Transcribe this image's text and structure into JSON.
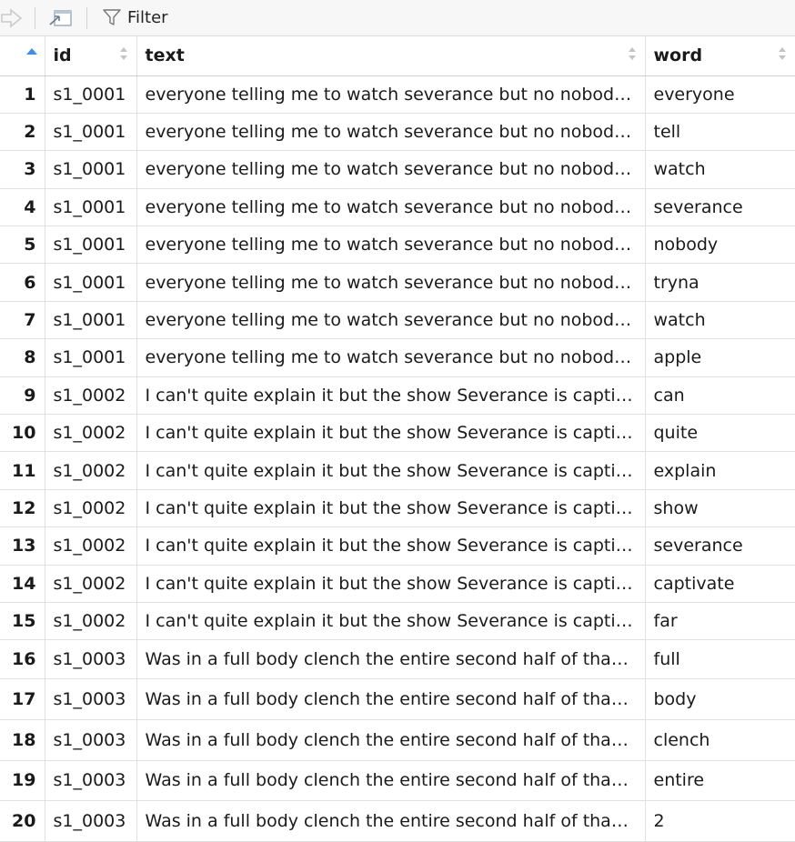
{
  "toolbar": {
    "filter_label": "Filter",
    "icons": [
      "forward-arrow-icon",
      "popout-window-icon",
      "filter-icon"
    ]
  },
  "table": {
    "columns": [
      {
        "label": "",
        "sort": "ascending"
      },
      {
        "label": "id",
        "sort": "none"
      },
      {
        "label": "text",
        "sort": "none"
      },
      {
        "label": "word",
        "sort": "none"
      }
    ],
    "rows": [
      {
        "n": "1",
        "id": "s1_0001",
        "text": "everyone telling me to watch severance but no nobod…",
        "word": "everyone"
      },
      {
        "n": "2",
        "id": "s1_0001",
        "text": "everyone telling me to watch severance but no nobod…",
        "word": "tell"
      },
      {
        "n": "3",
        "id": "s1_0001",
        "text": "everyone telling me to watch severance but no nobod…",
        "word": "watch"
      },
      {
        "n": "4",
        "id": "s1_0001",
        "text": "everyone telling me to watch severance but no nobod…",
        "word": "severance"
      },
      {
        "n": "5",
        "id": "s1_0001",
        "text": "everyone telling me to watch severance but no nobod…",
        "word": "nobody"
      },
      {
        "n": "6",
        "id": "s1_0001",
        "text": "everyone telling me to watch severance but no nobod…",
        "word": "tryna"
      },
      {
        "n": "7",
        "id": "s1_0001",
        "text": "everyone telling me to watch severance but no nobod…",
        "word": "watch"
      },
      {
        "n": "8",
        "id": "s1_0001",
        "text": "everyone telling me to watch severance but no nobod…",
        "word": "apple"
      },
      {
        "n": "9",
        "id": "s1_0002",
        "text": "I can't quite explain it but the show Severance is capti…",
        "word": "can"
      },
      {
        "n": "10",
        "id": "s1_0002",
        "text": "I can't quite explain it but the show Severance is capti…",
        "word": "quite"
      },
      {
        "n": "11",
        "id": "s1_0002",
        "text": "I can't quite explain it but the show Severance is capti…",
        "word": "explain"
      },
      {
        "n": "12",
        "id": "s1_0002",
        "text": "I can't quite explain it but the show Severance is capti…",
        "word": "show"
      },
      {
        "n": "13",
        "id": "s1_0002",
        "text": "I can't quite explain it but the show Severance is capti…",
        "word": "severance"
      },
      {
        "n": "14",
        "id": "s1_0002",
        "text": "I can't quite explain it but the show Severance is capti…",
        "word": "captivate"
      },
      {
        "n": "15",
        "id": "s1_0002",
        "text": "I can't quite explain it but the show Severance is capti…",
        "word": "far"
      },
      {
        "n": "16",
        "id": "s1_0003",
        "text": "Was in a full body clench the entire second half of tha…",
        "word": "full"
      },
      {
        "n": "17",
        "id": "s1_0003",
        "text": "Was in a full body clench the entire second half of tha…",
        "word": "body"
      },
      {
        "n": "18",
        "id": "s1_0003",
        "text": "Was in a full body clench the entire second half of tha…",
        "word": "clench"
      },
      {
        "n": "19",
        "id": "s1_0003",
        "text": "Was in a full body clench the entire second half of tha…",
        "word": "entire"
      },
      {
        "n": "20",
        "id": "s1_0003",
        "text": "Was in a full body clench the entire second half of tha…",
        "word": "2"
      }
    ]
  }
}
